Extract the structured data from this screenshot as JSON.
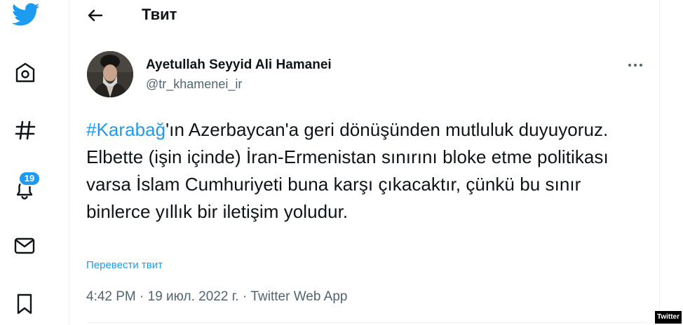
{
  "sidebar": {
    "items": [
      {
        "icon": "twitter-logo-icon"
      },
      {
        "icon": "home-icon"
      },
      {
        "icon": "hashtag-icon"
      },
      {
        "icon": "bell-icon",
        "badge": "19"
      },
      {
        "icon": "mail-icon"
      },
      {
        "icon": "bookmark-icon"
      }
    ]
  },
  "header": {
    "back_icon": "arrow-left-icon",
    "title": "Твит"
  },
  "tweet": {
    "author_name": "Ayetullah Seyyid Ali Hamanei",
    "handle": "@tr_khamenei_ir",
    "hashtag": "#Karabağ",
    "text_rest": "'ın Azerbaycan'a geri dönüşünden mutluluk duyuyoruz. Elbette (işin içinde) İran-Ermenistan sınırını bloke etme politikası varsa İslam Cumhuriyeti buna karşı çıkacaktır, çünkü bu sınır binlerce yıllık bir iletişim yoludur.",
    "translate_label": "Перевести твит",
    "meta": "4:42 PM · 19 июл. 2022 г. · Twitter Web App"
  },
  "watermark": "Twitter",
  "colors": {
    "accent": "#1d9bf0",
    "text": "#0f1419",
    "secondary": "#536471"
  }
}
